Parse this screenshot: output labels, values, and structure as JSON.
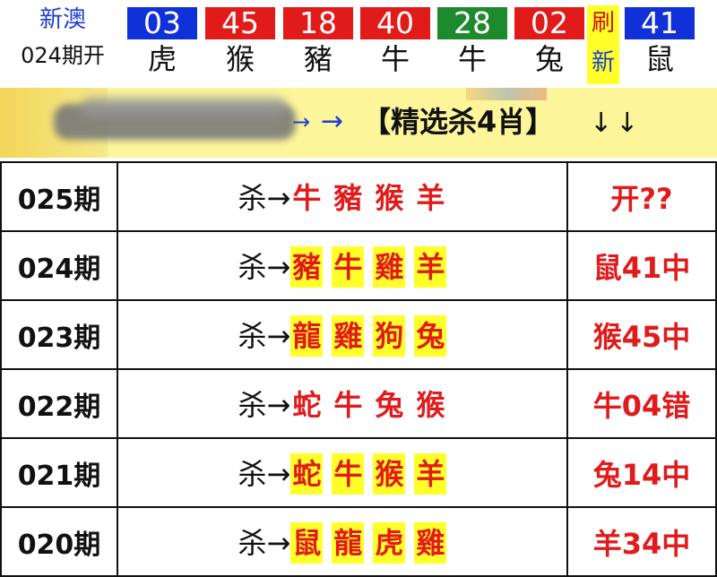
{
  "header": {
    "brand": "新澳",
    "period": "024期开",
    "refresh_top": "刷",
    "refresh_bottom": "新",
    "balls": [
      {
        "number": "03",
        "zodiac": "虎",
        "color": "#1030d8"
      },
      {
        "number": "45",
        "zodiac": "猴",
        "color": "#e11a1a"
      },
      {
        "number": "18",
        "zodiac": "豬",
        "color": "#e11a1a"
      },
      {
        "number": "40",
        "zodiac": "牛",
        "color": "#e11a1a"
      },
      {
        "number": "28",
        "zodiac": "牛",
        "color": "#1d8a2e"
      },
      {
        "number": "02",
        "zodiac": "兔",
        "color": "#e11a1a"
      },
      {
        "number": "41",
        "zodiac": "鼠",
        "color": "#1030d8"
      }
    ]
  },
  "banner": {
    "arrow_small": "→",
    "arrow_large": "→",
    "title": "【精选杀4肖】",
    "down_arrows": "↓↓"
  },
  "rows": [
    {
      "period": "025期",
      "kill_label": "杀→",
      "zodiacs": [
        "牛",
        "豬",
        "猴",
        "羊"
      ],
      "highlighted": false,
      "result": "开??"
    },
    {
      "period": "024期",
      "kill_label": "杀→",
      "zodiacs": [
        "豬",
        "牛",
        "雞",
        "羊"
      ],
      "highlighted": true,
      "result": "鼠41中"
    },
    {
      "period": "023期",
      "kill_label": "杀→",
      "zodiacs": [
        "龍",
        "雞",
        "狗",
        "兔"
      ],
      "highlighted": true,
      "result": "猴45中"
    },
    {
      "period": "022期",
      "kill_label": "杀→",
      "zodiacs": [
        "蛇",
        "牛",
        "兔",
        "猴"
      ],
      "highlighted": false,
      "result": "牛04错"
    },
    {
      "period": "021期",
      "kill_label": "杀→",
      "zodiacs": [
        "蛇",
        "牛",
        "猴",
        "羊"
      ],
      "highlighted": true,
      "result": "兔14中"
    },
    {
      "period": "020期",
      "kill_label": "杀→",
      "zodiacs": [
        "鼠",
        "龍",
        "虎",
        "雞"
      ],
      "highlighted": true,
      "result": "羊34中"
    }
  ],
  "colors": {
    "red": "#e01b1b",
    "blue": "#1e3fd0",
    "green": "#1d8a2e",
    "highlight_yellow": "#ffff2a",
    "banner_yellow": "#fcf59a"
  }
}
